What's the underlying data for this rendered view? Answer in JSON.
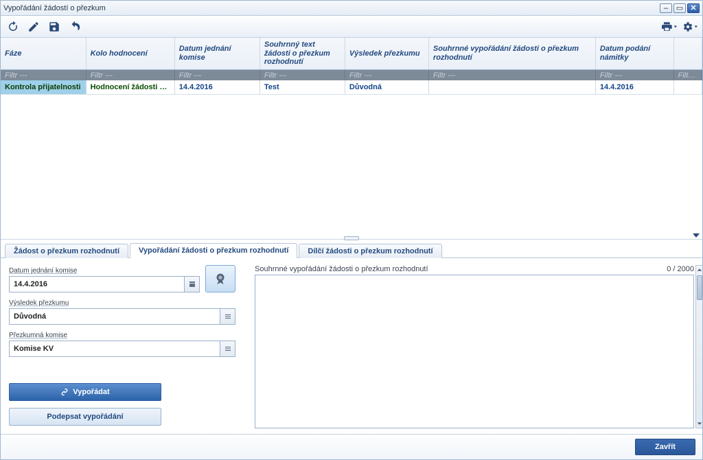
{
  "window": {
    "title": "Vypořádání žádostí o přezkum"
  },
  "grid": {
    "filter_placeholder": "Filtr ---",
    "columns": {
      "faze": "Fáze",
      "kolo": "Kolo hodnocení",
      "datum_komise": "Datum jednání komise",
      "souhrnny_text": "Souhrnný text žádosti o přezkum rozhodnutí",
      "vysledek": "Výsledek přezkumu",
      "souhrnne_vyporadani": "Souhrnné vypořádání žádosti o přezkum rozhodnutí",
      "datum_namitky": "Datum podání námitky",
      "extra": ""
    },
    "row": {
      "faze": "Kontrola přijatelnosti",
      "kolo": "Hodnocení žádosti o po",
      "datum_komise": "14.4.2016",
      "souhrnny_text": "Test",
      "vysledek": "Důvodná",
      "souhrnne_vyporadani": "",
      "datum_namitky": "14.4.2016",
      "extra": ""
    }
  },
  "tabs": {
    "t1": "Žádost o přezkum rozhodnutí",
    "t2": "Vypořádání žádosti o přezkum rozhodnutí",
    "t3": "Dílčí žádosti o přezkum rozhodnutí"
  },
  "form": {
    "datum_label": "Datum jednání komise",
    "datum_value": "14.4.2016",
    "vysledek_label": "Výsledek přezkumu",
    "vysledek_value": "Důvodná",
    "komise_label": "Přezkumná komise",
    "komise_value": "Komise KV",
    "vyporadat_btn": "Vypořádat",
    "podepsat_btn": "Podepsat vypořádání",
    "textarea_label": "Souhrnné vypořádání žádosti o přezkum rozhodnutí",
    "counter": "0 / 2000"
  },
  "footer": {
    "close": "Zavřít"
  }
}
